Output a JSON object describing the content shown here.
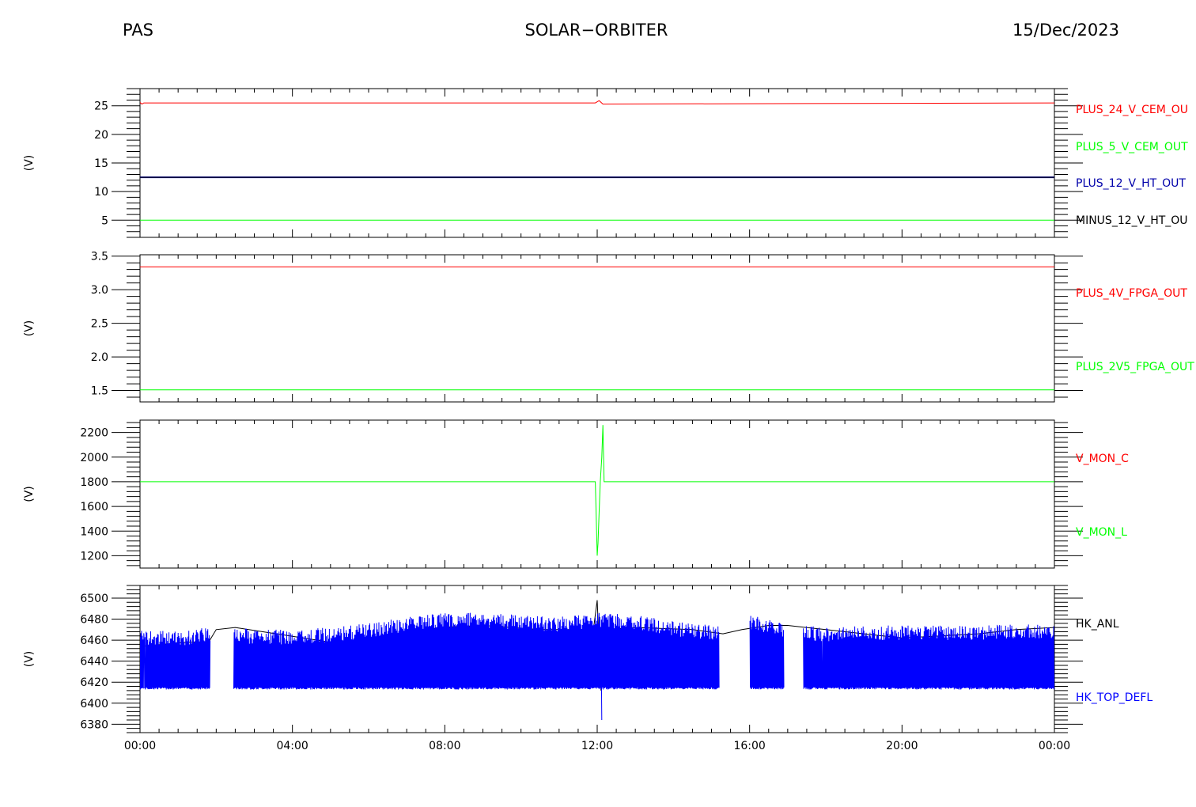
{
  "header": {
    "instrument": "PAS",
    "mission": "SOLAR−ORBITER",
    "date": "15/Dec/2023"
  },
  "chart_data": [
    {
      "type": "line",
      "ylabel": "(V)",
      "ylim": [
        2,
        28
      ],
      "yticks": [
        5,
        10,
        15,
        20,
        25
      ],
      "ytick_labels": [
        "5",
        "10",
        "15",
        "20",
        "25"
      ],
      "x_range_hours": [
        0,
        24
      ],
      "series": [
        {
          "name": "PLUS_24_V_CEM_OUT",
          "legend_text": "PLUS_24_V_CEM_OU",
          "color": "#ff0000",
          "hours": [
            0,
            0.05,
            0.1,
            11.95,
            12.05,
            12.15,
            24
          ],
          "values": [
            25.6,
            25.3,
            25.5,
            25.5,
            25.9,
            25.3,
            25.5
          ]
        },
        {
          "name": "PLUS_5_V_CEM_OUT",
          "legend_text": "PLUS_5_V_CEM_OUT",
          "color": "#00ff00",
          "hours": [
            0,
            24
          ],
          "values": [
            5.0,
            5.0
          ]
        },
        {
          "name": "PLUS_12_V_HT_OUT",
          "legend_text": "PLUS_12_V_HT_OUT",
          "color": "#0000aa",
          "hours": [
            0,
            24
          ],
          "values": [
            12.5,
            12.5
          ]
        },
        {
          "name": "MINUS_12_V_HT_OUT",
          "legend_text": "MINUS_12_V_HT_OU",
          "color": "#000000",
          "hours": [
            0,
            24
          ],
          "values": [
            12.5,
            12.5
          ]
        }
      ]
    },
    {
      "type": "line",
      "ylabel": "(V)",
      "ylim": [
        1.33,
        3.52
      ],
      "yticks": [
        1.5,
        2.0,
        2.5,
        3.0,
        3.5
      ],
      "ytick_labels": [
        "1.5",
        "2.0",
        "2.5",
        "3.0",
        "3.5"
      ],
      "x_range_hours": [
        0,
        24
      ],
      "series": [
        {
          "name": "PLUS_4V_FPGA_OUT",
          "legend_text": "PLUS_4V_FPGA_OUT",
          "color": "#ff0000",
          "hours": [
            0,
            24
          ],
          "values": [
            3.34,
            3.34
          ]
        },
        {
          "name": "PLUS_2V5_FPGA_OUT",
          "legend_text": "PLUS_2V5_FPGA_OUT",
          "color": "#00ff00",
          "hours": [
            0,
            24
          ],
          "values": [
            1.51,
            1.51
          ]
        }
      ]
    },
    {
      "type": "line",
      "ylabel": "(V)",
      "ylim": [
        1100,
        2300
      ],
      "yticks": [
        1200,
        1400,
        1600,
        1800,
        2000,
        2200
      ],
      "ytick_labels": [
        "1200",
        "1400",
        "1600",
        "1800",
        "2000",
        "2200"
      ],
      "x_range_hours": [
        0,
        24
      ],
      "series": [
        {
          "name": "V_MON_C",
          "legend_text": "V_MON_C",
          "color": "#ff0000",
          "hours": [],
          "values": []
        },
        {
          "name": "V_MON_L",
          "legend_text": "V_MON_L",
          "color": "#00ff00",
          "hours": [
            0,
            11.95,
            12.0,
            12.02,
            12.05,
            12.08,
            12.12,
            12.15,
            12.18,
            24
          ],
          "values": [
            1800,
            1800,
            1200,
            1300,
            1550,
            1800,
            2000,
            2260,
            1800,
            1800
          ]
        }
      ]
    },
    {
      "type": "line",
      "ylabel": "(V)",
      "ylim": [
        6372,
        6512
      ],
      "yticks": [
        6380,
        6400,
        6420,
        6440,
        6460,
        6480,
        6500
      ],
      "ytick_labels": [
        "6380",
        "6400",
        "6420",
        "6440",
        "6460",
        "6480",
        "6500"
      ],
      "x_range_hours": [
        0,
        24
      ],
      "xtick_labels": [
        "00:00",
        "04:00",
        "08:00",
        "12:00",
        "16:00",
        "20:00",
        "00:00"
      ],
      "series": [
        {
          "name": "HK_ANL",
          "legend_text": "HK_ANL",
          "color": "#000000",
          "hours": [
            0,
            1.2,
            1.8,
            2.0,
            2.5,
            5.0,
            6.0,
            7.0,
            7.8,
            9.0,
            10.5,
            11.9,
            12.0,
            12.1,
            12.2,
            13.0,
            14.5,
            15.3,
            15.8,
            16.5,
            17.0,
            18.0,
            19.0,
            20.0,
            21.0,
            22.0,
            23.0,
            24
          ],
          "values": [
            6454,
            6458,
            6458,
            6470,
            6472,
            6458,
            6460,
            6462,
            6472,
            6474,
            6470,
            6470,
            6498,
            6412,
            6470,
            6472,
            6470,
            6466,
            6470,
            6474,
            6474,
            6470,
            6466,
            6462,
            6464,
            6466,
            6470,
            6472
          ]
        },
        {
          "name": "HK_TOP_DEFL",
          "legend_text": "HK_TOP_DEFL",
          "color": "#0000ff",
          "band_low": 6413,
          "gaps_hours": [
            [
              1.85,
              2.45
            ],
            [
              15.2,
              16.0
            ],
            [
              16.9,
              17.4
            ]
          ],
          "hours": [
            0,
            1,
            2,
            3,
            4,
            5,
            6,
            7,
            8,
            9,
            10,
            11,
            12,
            13,
            14,
            15,
            16,
            17,
            18,
            19,
            20,
            21,
            22,
            23,
            24
          ],
          "values": [
            6470,
            6468,
            6474,
            6470,
            6470,
            6472,
            6476,
            6482,
            6486,
            6486,
            6484,
            6482,
            6486,
            6484,
            6478,
            6474,
            6484,
            6476,
            6472,
            6474,
            6474,
            6474,
            6474,
            6476,
            6474
          ]
        }
      ]
    }
  ]
}
